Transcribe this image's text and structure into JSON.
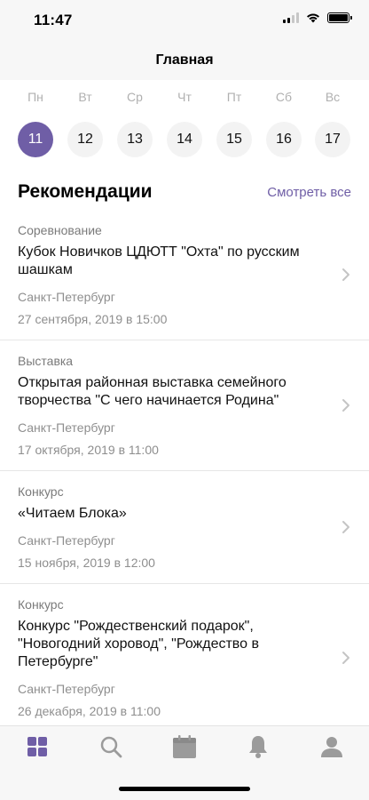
{
  "status_bar": {
    "time": "11:47"
  },
  "nav": {
    "title": "Главная"
  },
  "week": {
    "days": [
      "Пн",
      "Вт",
      "Ср",
      "Чт",
      "Пт",
      "Сб",
      "Вс"
    ],
    "dates": [
      "11",
      "12",
      "13",
      "14",
      "15",
      "16",
      "17"
    ],
    "selected_index": 0
  },
  "recommendations": {
    "title": "Рекомендации",
    "see_all": "Смотреть все",
    "events": [
      {
        "category": "Соревнование",
        "title": "Кубок Новичков ЦДЮТТ \"Охта\" по русским шашкам",
        "city": "Санкт-Петербург",
        "date": "27 сентября, 2019 в 15:00"
      },
      {
        "category": "Выставка",
        "title": "Открытая районная выставка семейного творчества \"С чего начинается Родина\"",
        "city": "Санкт-Петербург",
        "date": "17 октября, 2019 в 11:00"
      },
      {
        "category": "Конкурс",
        "title": "«Читаем Блока»",
        "city": "Санкт-Петербург",
        "date": "15 ноября, 2019 в 12:00"
      },
      {
        "category": "Конкурс",
        "title": "Конкурс \"Рождественский подарок\", \"Новогодний хоровод\", \"Рождество в Петербурге\"",
        "city": "Санкт-Петербург",
        "date": "26 декабря, 2019 в 11:00"
      }
    ]
  },
  "tabs": [
    {
      "icon": "grid-icon",
      "active": true
    },
    {
      "icon": "search-icon",
      "active": false
    },
    {
      "icon": "calendar-icon",
      "active": false
    },
    {
      "icon": "bell-icon",
      "active": false
    },
    {
      "icon": "profile-icon",
      "active": false
    }
  ],
  "colors": {
    "accent": "#6f5ea6",
    "inactive_icon": "#9b9b9b"
  }
}
